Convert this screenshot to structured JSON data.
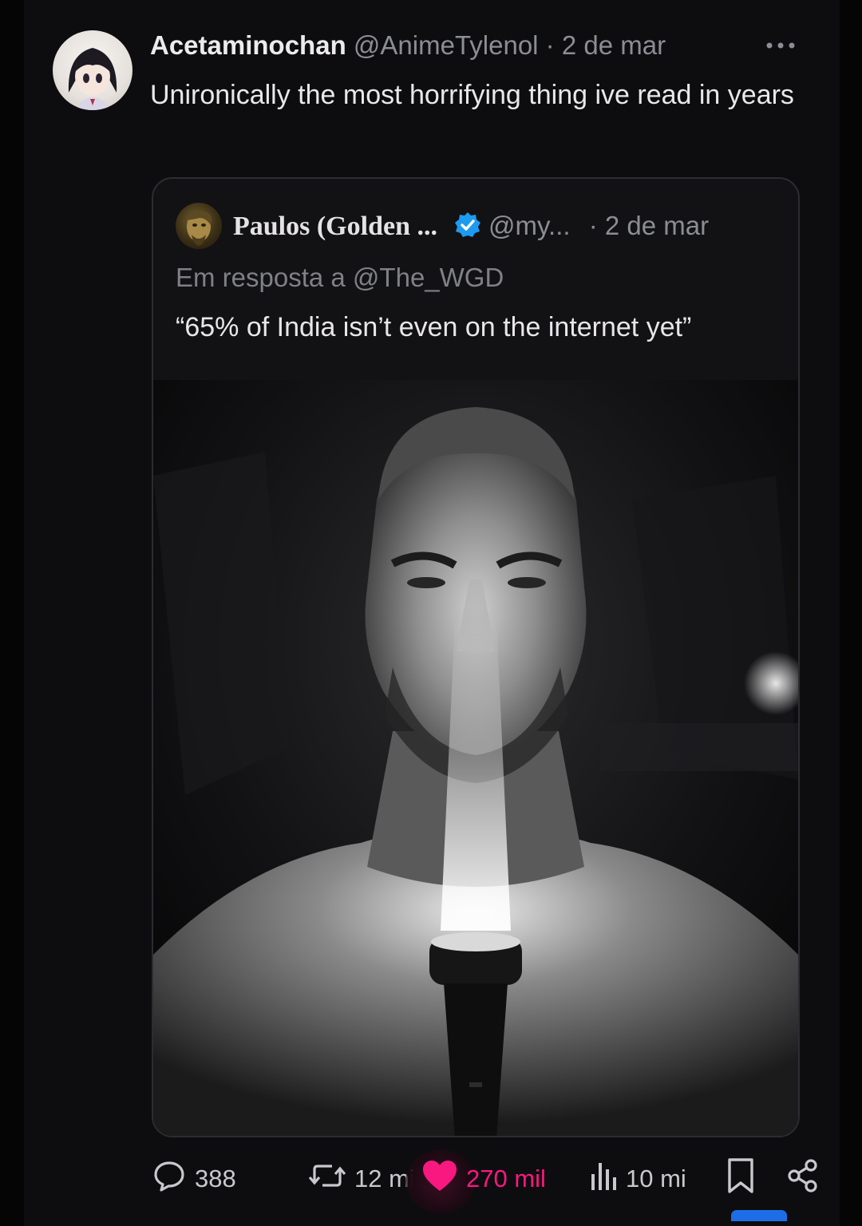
{
  "post": {
    "display_name": "Acetaminochan",
    "handle_date": "@AnimeTylenol · 2 de mar",
    "text": "Unironically the most horrifying thing ive read in years"
  },
  "quoted": {
    "display_name": "Paulos (Golden ...",
    "handle": "@my...",
    "date": "· 2 de mar",
    "reply_to": "Em resposta a @The_WGD",
    "text": "“65% of India isn’t even on the internet yet”"
  },
  "actions": {
    "replies": "388",
    "reposts": "12 mil",
    "likes": "270 mil",
    "views": "10 mi"
  },
  "icons": [
    "avatar-image",
    "more-icon",
    "verified-icon",
    "reply-icon",
    "repost-icon",
    "heart-icon",
    "views-icon",
    "bookmark-icon",
    "share-icon"
  ],
  "colors": {
    "like": "#f91880",
    "verified": "#1d9bf0",
    "background": "#0d0c0f"
  }
}
